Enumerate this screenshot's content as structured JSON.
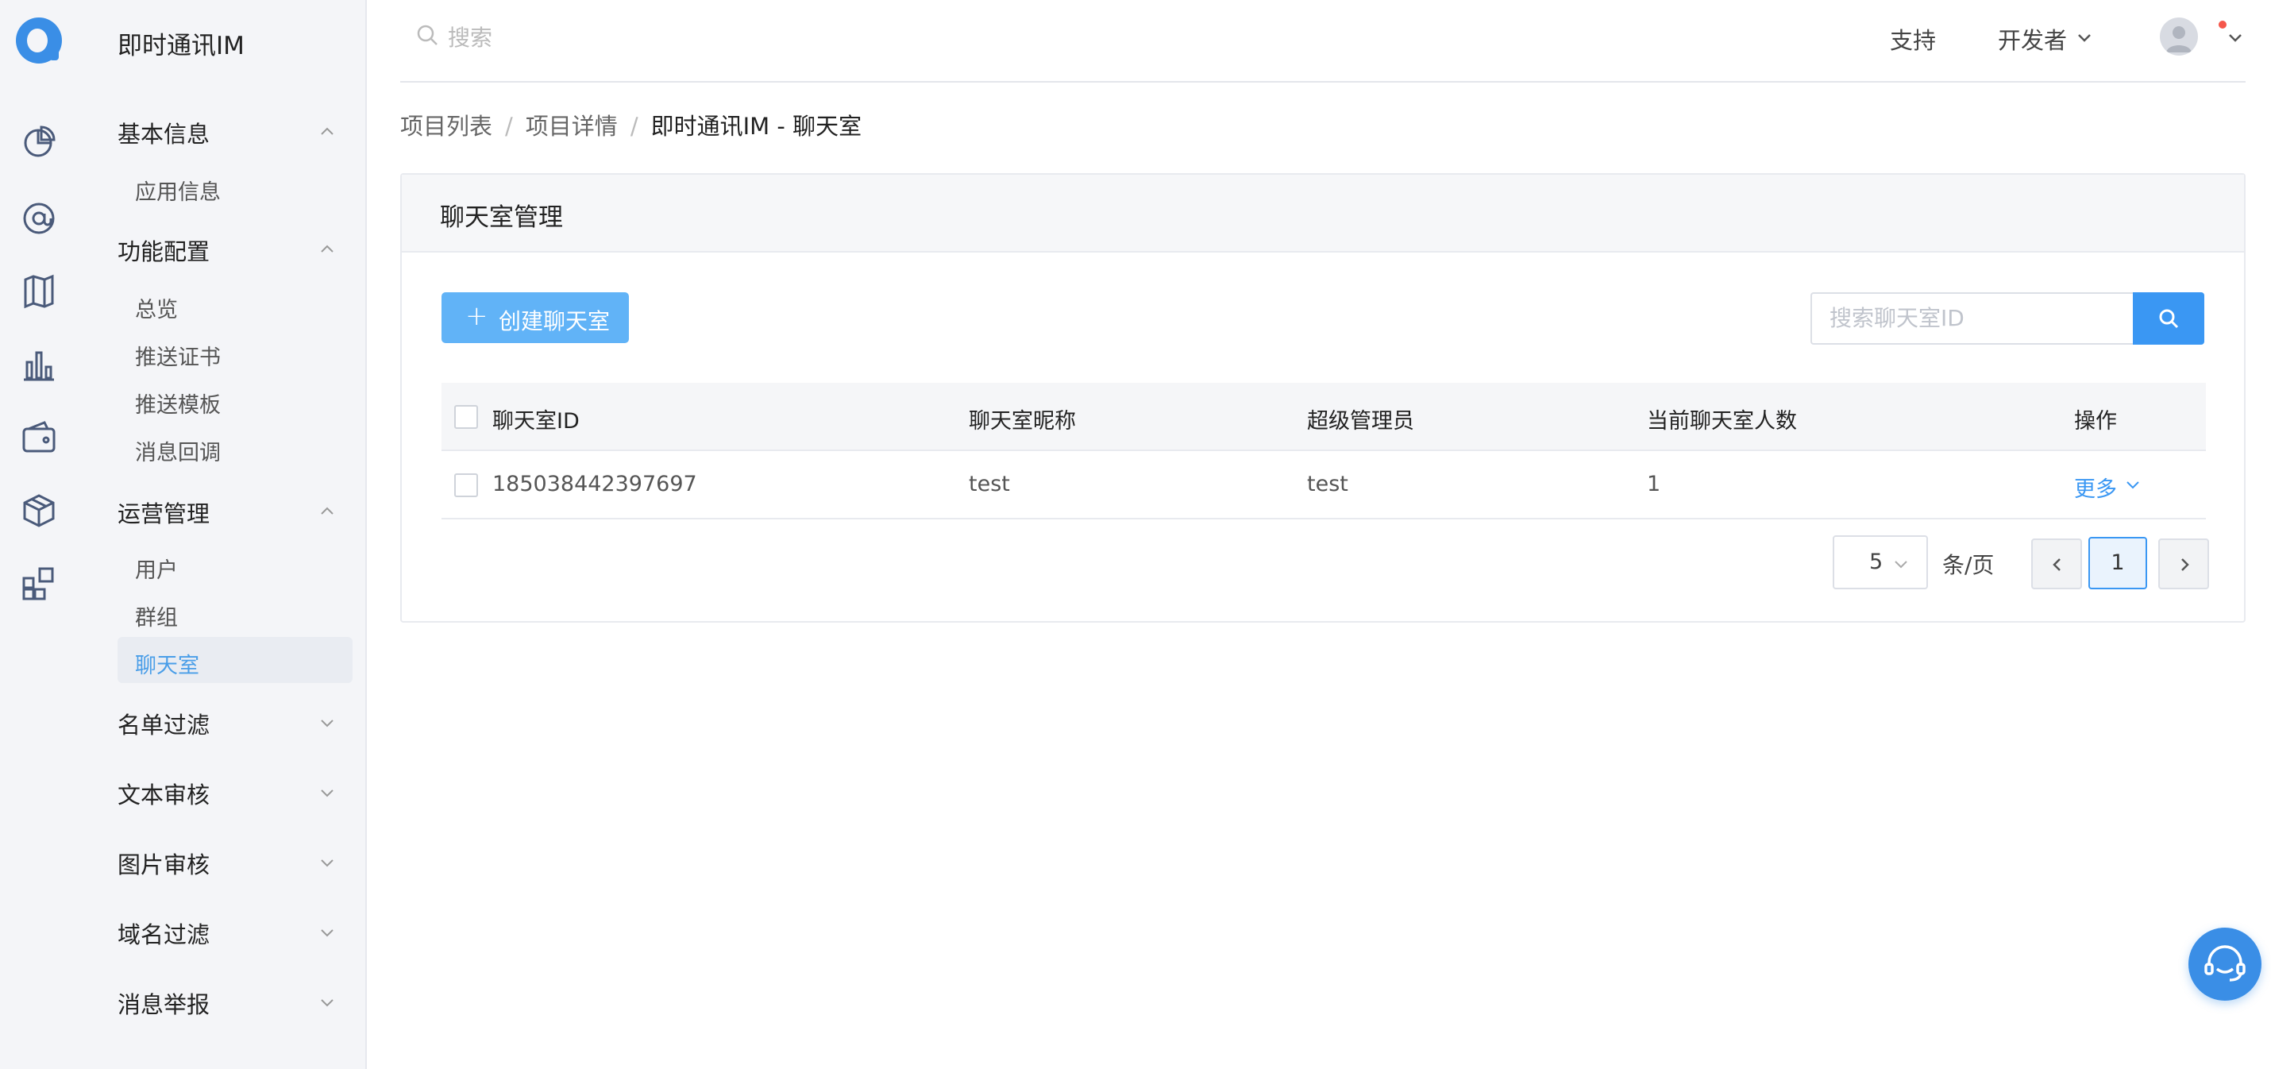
{
  "app": {
    "title": "即时通讯IM"
  },
  "rail": {
    "icons": [
      "logo-icon",
      "dashboard-icon",
      "at-icon",
      "map-icon",
      "bar-chart-icon",
      "wallet-icon",
      "cube-icon",
      "apps-icon"
    ]
  },
  "menu": {
    "groups": [
      {
        "label": "基本信息",
        "expanded": true,
        "items": [
          "应用信息"
        ]
      },
      {
        "label": "功能配置",
        "expanded": true,
        "items": [
          "总览",
          "推送证书",
          "推送模板",
          "消息回调"
        ]
      },
      {
        "label": "运营管理",
        "expanded": true,
        "items": [
          "用户",
          "群组",
          "聊天室"
        ],
        "active": "聊天室"
      },
      {
        "label": "名单过滤",
        "expanded": false
      },
      {
        "label": "文本审核",
        "expanded": false
      },
      {
        "label": "图片审核",
        "expanded": false
      },
      {
        "label": "域名过滤",
        "expanded": false
      },
      {
        "label": "消息举报",
        "expanded": false
      }
    ]
  },
  "topbar": {
    "search_placeholder": "搜索",
    "support": "支持",
    "developer": "开发者"
  },
  "breadcrumb": {
    "items": [
      "项目列表",
      "项目详情",
      "即时通讯IM - 聊天室"
    ],
    "separator": "/"
  },
  "card": {
    "title": "聊天室管理",
    "create_button": "创建聊天室",
    "search_placeholder": "搜索聊天室ID",
    "columns": [
      "聊天室ID",
      "聊天室昵称",
      "超级管理员",
      "当前聊天室人数",
      "操作"
    ],
    "rows": [
      {
        "id": "185038442397697",
        "nickname": "test",
        "admin": "test",
        "count": "1",
        "action": "更多"
      }
    ],
    "pagination": {
      "page_size": "5",
      "per_page_label": "条/页",
      "current_page": "1"
    }
  },
  "colors": {
    "accent": "#3a97f3",
    "create_button": "#61b3f7",
    "active_menu_text": "#4a9ee8",
    "notification_dot": "#f5574b"
  }
}
